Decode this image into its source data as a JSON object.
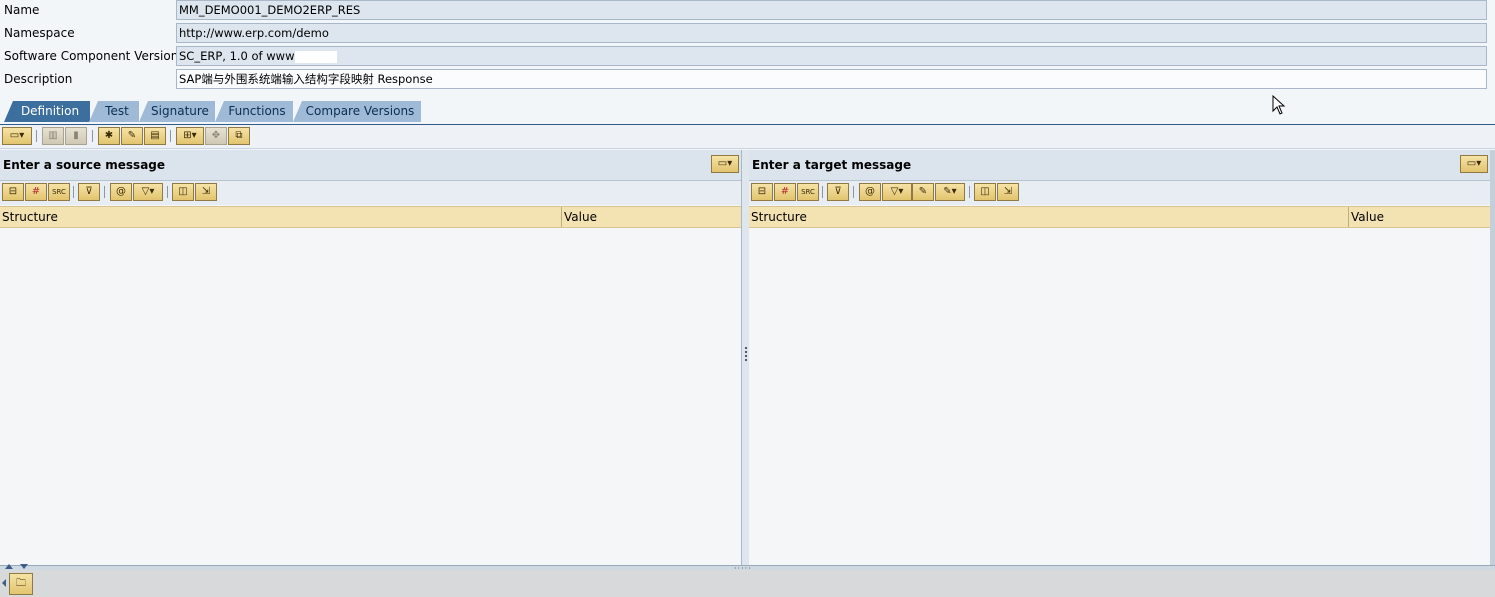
{
  "header": {
    "fields": [
      {
        "label": "Name",
        "value": "MM_DEMO001_DEMO2ERP_RES"
      },
      {
        "label": "Namespace",
        "value": "http://www.erp.com/demo"
      },
      {
        "label": "Software Component Version",
        "value": "SC_ERP, 1.0 of www"
      },
      {
        "label": "Description",
        "value": "SAP端与外围系统端输入结构字段映射 Response"
      }
    ]
  },
  "tabs": [
    {
      "label": "Definition",
      "active": true
    },
    {
      "label": "Test",
      "active": false
    },
    {
      "label": "Signature",
      "active": false
    },
    {
      "label": "Functions",
      "active": false
    },
    {
      "label": "Compare Versions",
      "active": false
    }
  ],
  "main_toolbar": {
    "icons": [
      "display-mode-dropdown-icon",
      "copy-object-icon",
      "delete-icon",
      "settings-gear-icon",
      "edit-document-icon",
      "table-layout-icon",
      "dependency-dropdown-icon",
      "move-icon",
      "window-icon"
    ]
  },
  "source_pane": {
    "title": "Enter a source message",
    "toolbar_icons": [
      "tree-icon",
      "grid-icon",
      "source-code-icon",
      "expand-icon",
      "constant-icon",
      "filter-dropdown-icon",
      "find-icon",
      "export-icon"
    ],
    "columns": [
      "Structure",
      "Value"
    ]
  },
  "target_pane": {
    "title": "Enter a target message",
    "toolbar_icons": [
      "tree-icon",
      "grid-icon",
      "source-code-icon",
      "expand-icon",
      "constant-icon",
      "filter-dropdown-icon",
      "edit-icon",
      "edit-dropdown-icon",
      "find-icon",
      "export-icon"
    ],
    "columns": [
      "Structure",
      "Value"
    ]
  },
  "colors": {
    "tab_active": "#3d6f9e",
    "tab_inactive": "#9fbad6",
    "column_header": "#f4e3b2",
    "button": "#e2c46e"
  }
}
